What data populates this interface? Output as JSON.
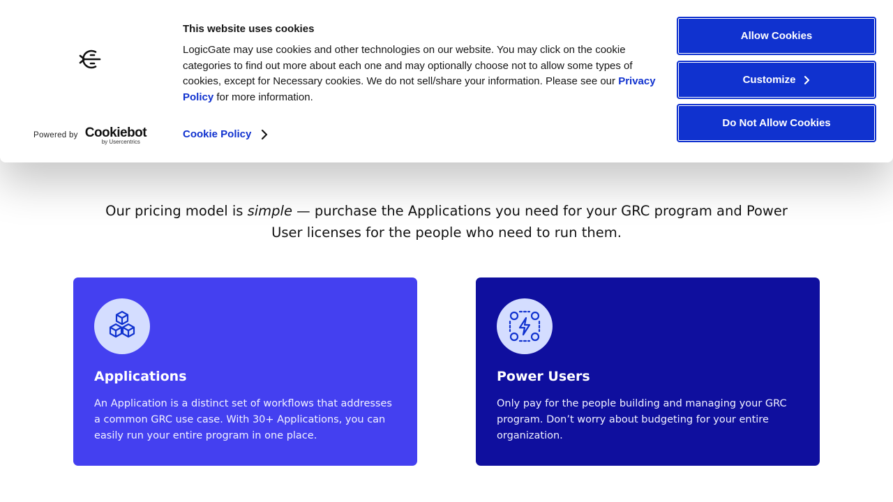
{
  "banner": {
    "title": "This website uses cookies",
    "text_before_link": "LogicGate may use cookies and other technologies on our website. You may click on the cookie categories to find out more about each one and may optionally choose not to allow some types of cookies, except for Necessary cookies.  We do not sell/share your information. Please see our ",
    "privacy_link": "Privacy Policy",
    "text_after_link": " for more information.",
    "cookie_policy_label": "Cookie Policy",
    "powered_by": "Powered by",
    "cookiebot_name": "Cookiebot",
    "cookiebot_sub": "by Usercentrics",
    "buttons": {
      "allow": "Allow Cookies",
      "customize": "Customize",
      "deny": "Do Not Allow Cookies"
    },
    "accent_color": "#1032cf"
  },
  "intro": {
    "prefix": "Our pricing model is ",
    "emphasis": "simple",
    "suffix": " — purchase the Applications you need for your GRC program and Power User licenses for the people who need to run them."
  },
  "cards": [
    {
      "icon": "cubes-icon",
      "title": "Applications",
      "text": "An Application is a distinct set of workflows that addresses a common GRC use case. With 30+ Applications, you can easily run your entire program in one place.",
      "color": "#4440f0"
    },
    {
      "icon": "power-users-icon",
      "title": "Power Users",
      "text": "Only pay for the people building and managing your GRC program. Don’t worry about budgeting for your entire organization.",
      "color": "#0f0f9e"
    }
  ]
}
